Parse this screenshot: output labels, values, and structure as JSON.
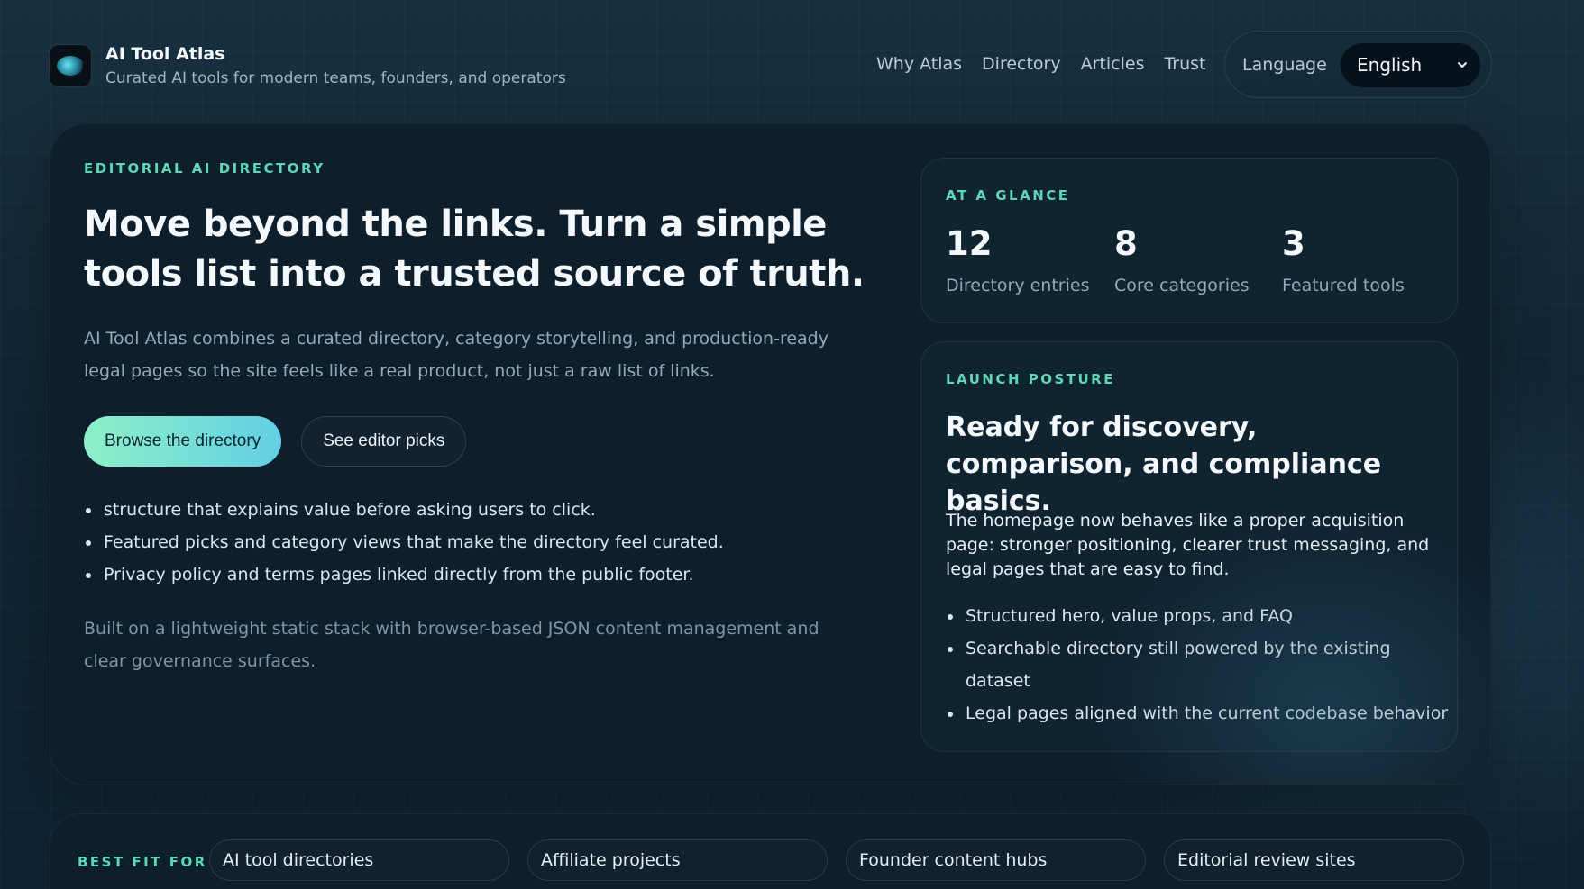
{
  "header": {
    "brand_title": "AI Tool Atlas",
    "brand_subtitle": "Curated AI tools for modern teams, founders, and operators",
    "logo_icon": "atlas-globe-logo",
    "nav": [
      "Why Atlas",
      "Directory",
      "Articles",
      "Trust"
    ],
    "language_label": "Language",
    "language_selected": "English"
  },
  "hero": {
    "eyebrow": "EDITORIAL AI DIRECTORY",
    "title": "Move beyond the links. Turn a simple tools list into a trusted source of truth.",
    "description": "AI Tool Atlas combines a curated directory, category storytelling, and production-ready legal pages so the site feels like a real product, not just a raw list of links.",
    "primary_button": "Browse the directory",
    "secondary_button": "See editor picks",
    "bullets": [
      "structure that explains value before asking users to click.",
      "Featured picks and category views that make the directory feel curated.",
      "Privacy policy and terms pages linked directly from the public footer."
    ],
    "footnote": "Built on a lightweight static stack with browser-based JSON content management and clear governance surfaces."
  },
  "glance": {
    "eyebrow": "AT A GLANCE",
    "stats": [
      {
        "value": "12",
        "label": "Directory entries"
      },
      {
        "value": "8",
        "label": "Core categories"
      },
      {
        "value": "3",
        "label": "Featured tools"
      }
    ]
  },
  "posture": {
    "eyebrow": "LAUNCH POSTURE",
    "title": "Ready for discovery, comparison, and compliance basics.",
    "description": "The homepage now behaves like a proper acquisition page: stronger positioning, clearer trust messaging, and legal pages that are easy to find.",
    "items": [
      "Structured hero, value props, and FAQ",
      "Searchable directory still powered by the existing dataset",
      "Legal pages aligned with the current codebase behavior"
    ]
  },
  "bestfit": {
    "eyebrow": "BEST FIT FOR",
    "chips": [
      "AI tool directories",
      "Affiliate projects",
      "Founder content hubs",
      "Editorial review sites"
    ]
  },
  "colors": {
    "accent": "#5fd6b6",
    "button_gradient_start": "#8ef0c7",
    "button_gradient_end": "#63cfe5",
    "card_bg": "#0d1e2c"
  }
}
